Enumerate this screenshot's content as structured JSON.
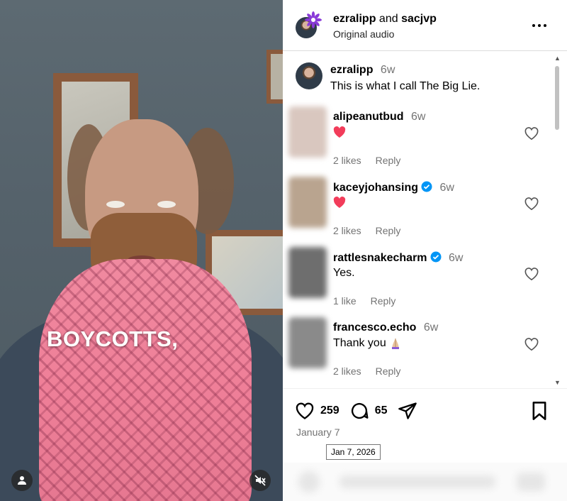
{
  "video": {
    "caption_text": "BOYCOTTS,",
    "user_icon": "person-icon",
    "mute_icon": "speaker-muted-icon"
  },
  "post": {
    "authors": "ezralipp",
    "and_text": "and",
    "collaborator": "sacjvp",
    "audio": "Original audio",
    "more_icon": "ellipsis-icon"
  },
  "caption": {
    "username": "ezralipp",
    "age": "6w",
    "text": "This is what I call The Big Lie."
  },
  "comments": [
    {
      "username": "alipeanutbud",
      "verified": false,
      "age": "6w",
      "text": "",
      "emoji": "heart",
      "likes": "2 likes",
      "reply": "Reply",
      "avatar_color": "#d9c7bf"
    },
    {
      "username": "kaceyjohansing",
      "verified": true,
      "age": "6w",
      "text": "",
      "emoji": "heart",
      "likes": "2 likes",
      "reply": "Reply",
      "avatar_color": "#b9a48f"
    },
    {
      "username": "rattlesnakecharm",
      "verified": true,
      "age": "6w",
      "text": "Yes.",
      "emoji": "",
      "likes": "1 like",
      "reply": "Reply",
      "avatar_color": "#6e6e6e"
    },
    {
      "username": "francesco.echo",
      "verified": false,
      "age": "6w",
      "text": "Thank you",
      "emoji": "praying-hands",
      "likes": "2 likes",
      "reply": "Reply",
      "avatar_color": "#8a8a8a"
    }
  ],
  "actions": {
    "likes": "259",
    "comments": "65",
    "like_icon": "heart-outline-icon",
    "comment_icon": "speech-bubble-icon",
    "share_icon": "paper-plane-icon",
    "save_icon": "bookmark-icon"
  },
  "date": "January 7",
  "date_tooltip": "Jan 7, 2026",
  "colors": {
    "verified": "#0095f6",
    "heart_emoji": "#f23c5a",
    "secondary_text": "#737373",
    "badge": "#8a3bd8"
  }
}
